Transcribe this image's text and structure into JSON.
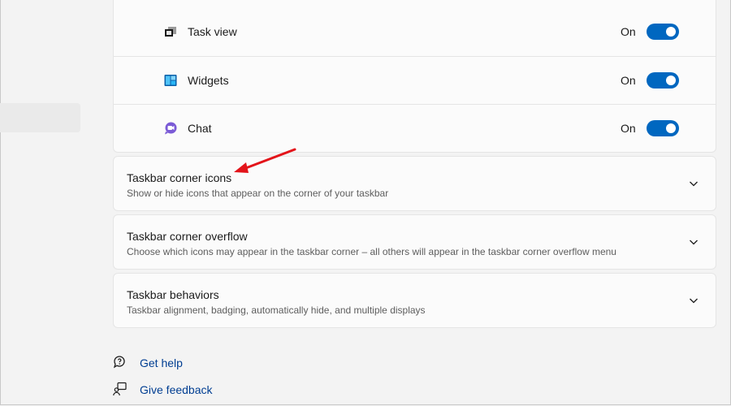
{
  "rows": [
    {
      "label": "Task view",
      "state": "On",
      "icon": "task-view-icon"
    },
    {
      "label": "Widgets",
      "state": "On",
      "icon": "widgets-icon"
    },
    {
      "label": "Chat",
      "state": "On",
      "icon": "chat-icon"
    }
  ],
  "sections": [
    {
      "title": "Taskbar corner icons",
      "subtitle": "Show or hide icons that appear on the corner of your taskbar"
    },
    {
      "title": "Taskbar corner overflow",
      "subtitle": "Choose which icons may appear in the taskbar corner – all others will appear in the taskbar corner overflow menu"
    },
    {
      "title": "Taskbar behaviors",
      "subtitle": "Taskbar alignment, badging, automatically hide, and multiple displays"
    }
  ],
  "links": {
    "help": "Get help",
    "feedback": "Give feedback"
  },
  "colors": {
    "accent": "#0067c0",
    "link": "#003e92",
    "annotation": "#e3141a"
  }
}
